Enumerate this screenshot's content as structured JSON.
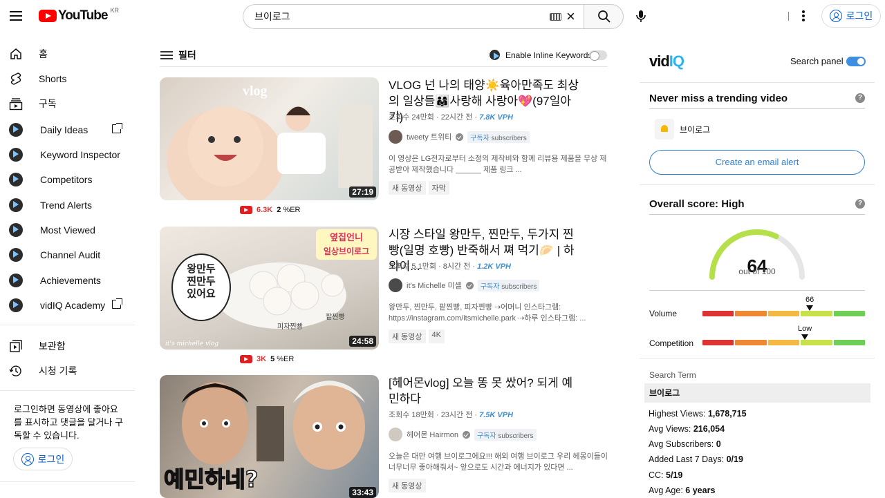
{
  "header": {
    "logo_text": "YouTube",
    "country": "KR",
    "search_value": "브이로그",
    "login_label": "로그인"
  },
  "sidebar": {
    "items": [
      {
        "label": "홈",
        "icon": "home-icon"
      },
      {
        "label": "Shorts",
        "icon": "shorts-icon"
      },
      {
        "label": "구독",
        "icon": "subscriptions-icon"
      },
      {
        "label": "Daily Ideas",
        "icon": "vidiq-icon",
        "external": true
      },
      {
        "label": "Keyword Inspector",
        "icon": "vidiq-icon"
      },
      {
        "label": "Competitors",
        "icon": "vidiq-icon"
      },
      {
        "label": "Trend Alerts",
        "icon": "vidiq-icon"
      },
      {
        "label": "Most Viewed",
        "icon": "vidiq-icon"
      },
      {
        "label": "Channel Audit",
        "icon": "vidiq-icon"
      },
      {
        "label": "Achievements",
        "icon": "vidiq-icon"
      },
      {
        "label": "vidIQ Academy",
        "icon": "vidiq-icon",
        "external": true
      }
    ],
    "library": "보관함",
    "history": "시청 기록",
    "note": "로그인하면 동영상에 좋아요를 표시하고 댓글을 달거나 구독할 수 있습니다.",
    "login_label": "로그인"
  },
  "filterbar": {
    "filter_label": "필터",
    "inline_keywords": "Enable Inline Keywords"
  },
  "videos": [
    {
      "title": "VLOG 넌 나의 태양☀️육아만족도 최상의 일상들👨‍👩‍👧사랑해 사랑아💖(97일아기)",
      "views": "조회수 24만회",
      "age": "22시간 전",
      "vph": "7.8K VPH",
      "channel": "tweety 트위티",
      "subs_prefix": "구독자",
      "subs_suffix": "subscribers",
      "desc": "이 영상은 LG전자로부터 소정의 제작비와 함께 리뷰용 제품을 무상 제공받아 제작했습니다 ______ 제품 링크 ...",
      "badges": [
        "새 동영상",
        "자막"
      ],
      "duration": "27:19",
      "stat_views": "6.3K",
      "stat_er": "2",
      "stat_er_unit": "%ER"
    },
    {
      "title": "시장 스타일 왕만두, 찐만두, 두가지 찐빵(일명 호빵) 반죽해서 쪄 먹기🥟 | 하와이...",
      "views": "조회수 5.1만회",
      "age": "8시간 전",
      "vph": "1.2K VPH",
      "channel": "it's Michelle 미셸",
      "subs_prefix": "구독자",
      "subs_suffix": "subscribers",
      "desc": "왕만두, 찐만두, 팥찐빵, 피자찐빵 ⇢어머니 인스타그램: https://instagram.com/itsmichelle.park ⇢하루 인스타그램: ...",
      "badges": [
        "새 동영상",
        "4K"
      ],
      "duration": "24:58",
      "stat_views": "3K",
      "stat_er": "5",
      "stat_er_unit": "%ER"
    },
    {
      "title": "[헤어몬vlog] 오늘 똥 못 쌌어? 되게 예민하다",
      "views": "조회수 18만회",
      "age": "23시간 전",
      "vph": "7.5K VPH",
      "channel": "헤어몬 Hairmon",
      "subs_prefix": "구독자",
      "subs_suffix": "subscribers",
      "desc": "오늘은 대만 여행 브이로그에요!!! 해외 여행 브이로그 우리 헤몽이들이 너무너무 좋아해줘서~ 앞으로도 시간과 에너지가 있다면 ...",
      "badges": [
        "새 동영상"
      ],
      "duration": "33:43"
    }
  ],
  "thumbs": {
    "t1": "vlog",
    "t2a": "옆집언니",
    "t2b": "일상브이로그",
    "t2c": "왕만두\n찐만두\n있어요",
    "t2d": "피자찐빵",
    "t2e": "팥찐빵",
    "t2f": "it's michelle vlog",
    "t3": "예민하네?"
  },
  "panel": {
    "search_panel": "Search panel",
    "trending_title": "Never miss a trending video",
    "alert_keyword": "브이로그",
    "email_btn": "Create an email alert",
    "score_title": "Overall score: High",
    "score": "64",
    "out_of": "out of 100",
    "volume_label": "Volume",
    "volume_marker": "66",
    "volume_level": 0.66,
    "competition_label": "Competition",
    "competition_marker": "Low",
    "competition_level": 0.63,
    "search_term_label": "Search Term",
    "search_term": "브이로그",
    "stats": [
      {
        "k": "Highest Views: ",
        "v": "1,678,715"
      },
      {
        "k": "Avg Views: ",
        "v": "216,054"
      },
      {
        "k": "Avg Subscribers: ",
        "v": "0"
      },
      {
        "k": "Added Last 7 Days: ",
        "v": "0/19"
      },
      {
        "k": "CC: ",
        "v": "5/19"
      },
      {
        "k": "Avg Age: ",
        "v": "6 years"
      }
    ],
    "gauge_fraction": 0.64,
    "meter_colors": [
      "#dd3333",
      "#ee8833",
      "#f4b942",
      "#c8e04a",
      "#6fcf55"
    ]
  }
}
